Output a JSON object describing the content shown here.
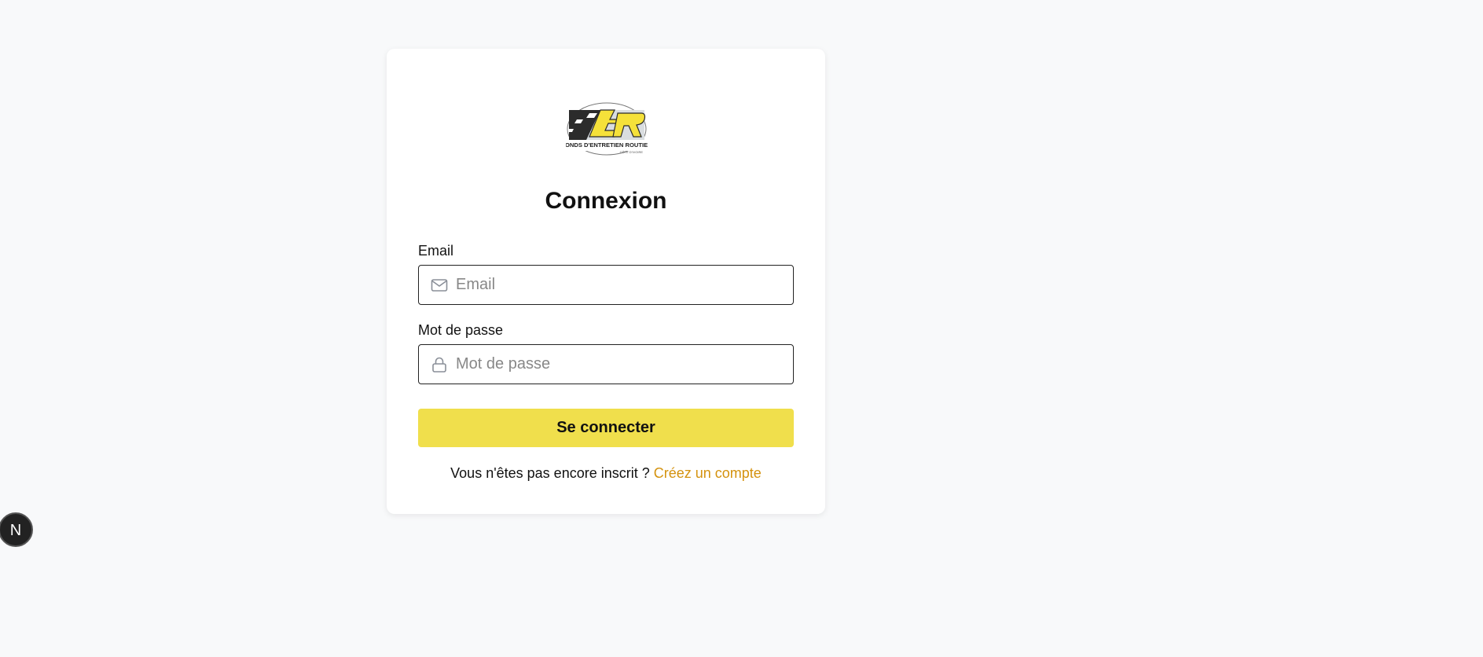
{
  "logo": {
    "text": "FONDS D'ENTRETIEN ROUTIER",
    "subtext": "CÔTE D'IVOIRE",
    "brand_colors": {
      "dark": "#2b2b2b",
      "yellow": "#f5e13a"
    }
  },
  "login": {
    "title": "Connexion",
    "email_label": "Email",
    "email_placeholder": "Email",
    "email_value": "",
    "password_label": "Mot de passe",
    "password_placeholder": "Mot de passe",
    "password_value": "",
    "submit_label": "Se connecter"
  },
  "signup": {
    "prompt": "Vous n'êtes pas encore inscrit ? ",
    "link_label": "Créez un compte"
  },
  "dev_badge": {
    "letter": "N"
  },
  "colors": {
    "accent": "#f0df4c",
    "link": "#d4920e",
    "background": "#f8f9fa"
  }
}
